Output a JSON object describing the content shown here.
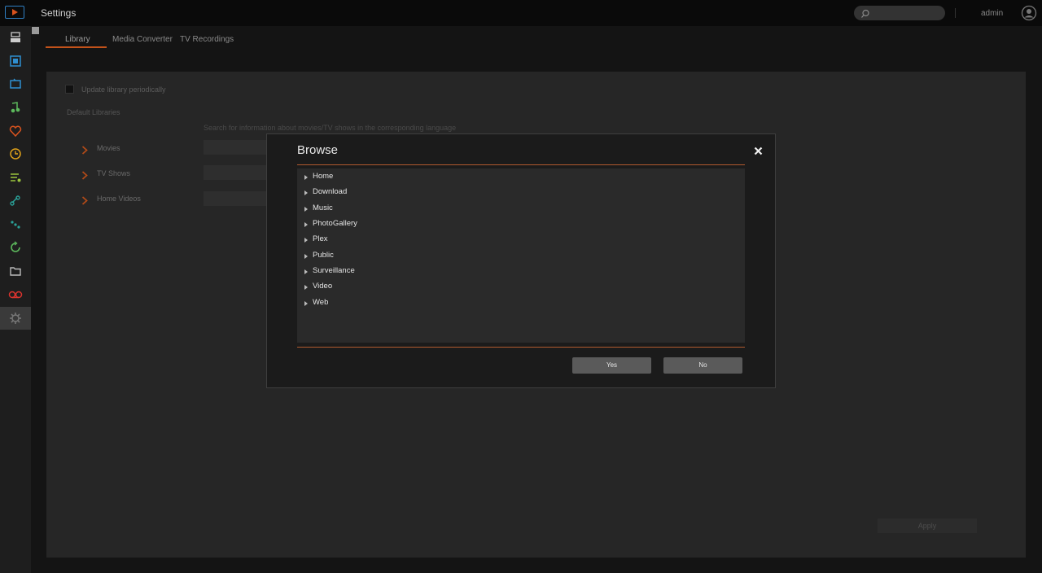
{
  "header": {
    "title": "Settings",
    "user": "admin",
    "search": {
      "value": "",
      "icon": "search-icon"
    }
  },
  "sidebar": {
    "icons": [
      "media-server-icon",
      "film-icon",
      "tv-icon",
      "music-icon",
      "heart-icon",
      "clock-icon",
      "playlist-icon",
      "link-icon",
      "dots-icon",
      "refresh-icon",
      "folder-icon",
      "record-icon",
      "gear-icon"
    ],
    "active_index": 12
  },
  "tabs": [
    "Library",
    "Media Converter",
    "TV Recordings"
  ],
  "library": {
    "update_periodically_label": "Update library periodically",
    "default_libraries_label": "Default Libraries",
    "search_hint": "Search for information about movies/TV shows in the corresponding language",
    "items": [
      "Movies",
      "TV Shows",
      "Home Videos"
    ],
    "apply_label": "Apply"
  },
  "dialog": {
    "title": "Browse",
    "folders": [
      "Home",
      "Download",
      "Music",
      "PhotoGallery",
      "Plex",
      "Public",
      "Surveillance",
      "Video",
      "Web"
    ],
    "yes_label": "Yes",
    "no_label": "No"
  },
  "colors": {
    "accent": "#c2521a",
    "background": "#141414",
    "panel": "#262626",
    "dialog": "#1b1b1b"
  }
}
